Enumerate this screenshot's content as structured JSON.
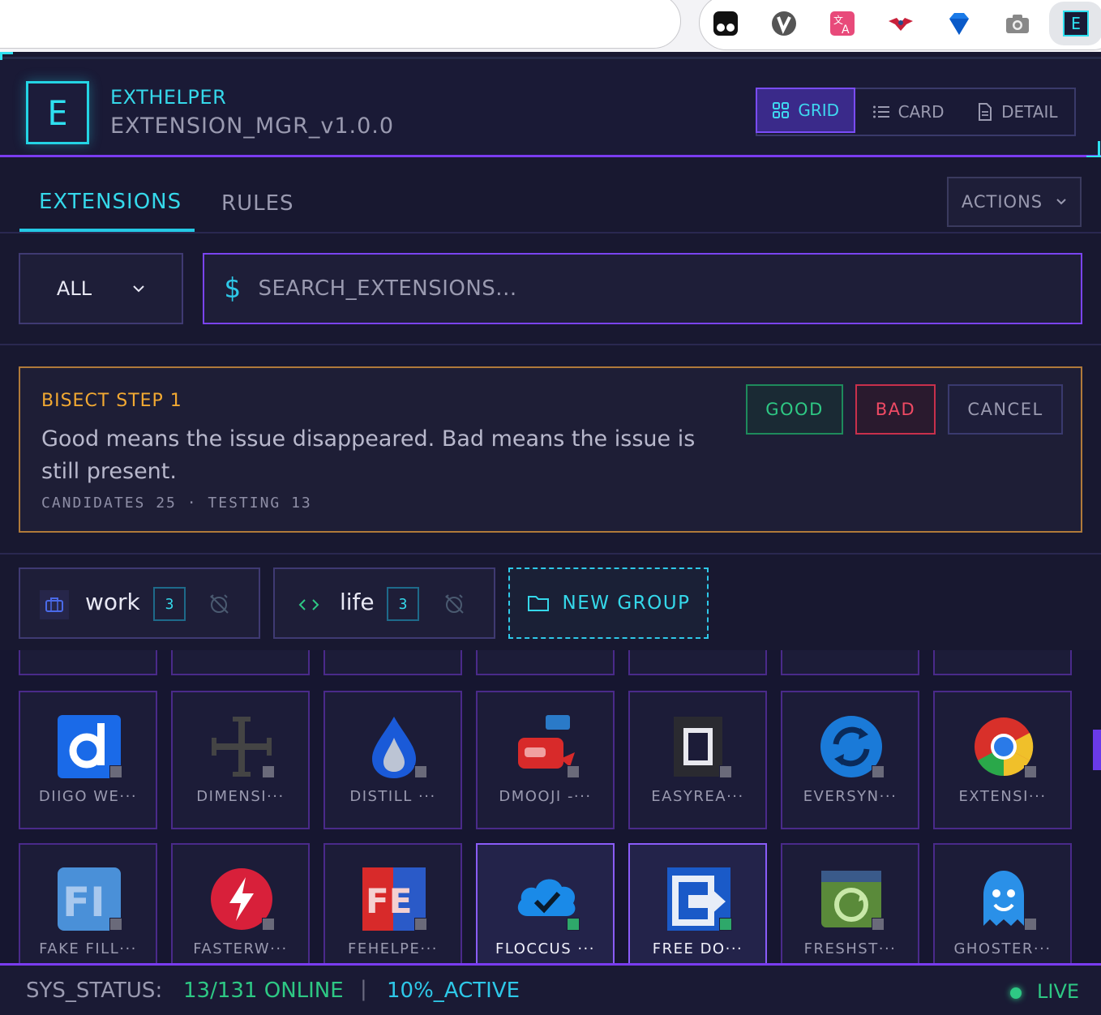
{
  "browser": {
    "extension_icons": [
      "tampermonkey-icon",
      "vimium-icon",
      "translate-icon",
      "bird-icon",
      "gem-icon",
      "camera-icon",
      "exthelper-icon"
    ],
    "active_extension_letter": "E"
  },
  "header": {
    "logo_letter": "E",
    "app_name": "EXTHELPER",
    "version": "EXTENSION_MGR_v1.0.0",
    "views": [
      {
        "label": "GRID",
        "icon": "grid-icon",
        "active": true
      },
      {
        "label": "CARD",
        "icon": "list-icon",
        "active": false
      },
      {
        "label": "DETAIL",
        "icon": "document-icon",
        "active": false
      }
    ]
  },
  "tabs": {
    "items": [
      {
        "label": "EXTENSIONS",
        "active": true
      },
      {
        "label": "RULES",
        "active": false
      }
    ],
    "actions_label": "ACTIONS"
  },
  "filter": {
    "selected": "ALL",
    "search_prompt": "$",
    "search_placeholder": "SEARCH_EXTENSIONS..."
  },
  "bisect": {
    "title": "BISECT STEP 1",
    "message": "Good means the issue disappeared. Bad means the issue is still present.",
    "meta": "CANDIDATES 25 · TESTING 13",
    "good_label": "GOOD",
    "bad_label": "BAD",
    "cancel_label": "CANCEL"
  },
  "groups": [
    {
      "name": "work",
      "count": "3",
      "icon": "briefcase-icon"
    },
    {
      "name": "life",
      "count": "3",
      "icon": "code-icon"
    }
  ],
  "new_group_label": "NEW GROUP",
  "extensions": [
    {
      "name": "DIIGO WE···",
      "icon": "diigo-icon",
      "enabled": false
    },
    {
      "name": "DIMENSI···",
      "icon": "dimensions-icon",
      "enabled": false
    },
    {
      "name": "DISTILL ···",
      "icon": "distill-icon",
      "enabled": false
    },
    {
      "name": "DMOOJI -···",
      "icon": "dmooji-icon",
      "enabled": false
    },
    {
      "name": "EASYREA···",
      "icon": "easyread-icon",
      "enabled": false
    },
    {
      "name": "EVERSYN···",
      "icon": "eversync-icon",
      "enabled": false
    },
    {
      "name": "EXTENSI···",
      "icon": "chrome-icon",
      "enabled": false
    },
    {
      "name": "FAKE FILL···",
      "icon": "fakefiller-icon",
      "enabled": false
    },
    {
      "name": "FASTERW···",
      "icon": "fasterweb-icon",
      "enabled": false
    },
    {
      "name": "FEHELPE···",
      "icon": "fehelper-icon",
      "enabled": false
    },
    {
      "name": "FLOCCUS ···",
      "icon": "floccus-icon",
      "enabled": true
    },
    {
      "name": "FREE DO···",
      "icon": "freedownload-icon",
      "enabled": true
    },
    {
      "name": "FRESHST···",
      "icon": "freshstart-icon",
      "enabled": false
    },
    {
      "name": "GHOSTER···",
      "icon": "ghostery-icon",
      "enabled": false
    }
  ],
  "status": {
    "label": "SYS_STATUS:",
    "online": "13/131 ONLINE",
    "separator": "|",
    "active": "10%_ACTIVE",
    "live": "LIVE"
  },
  "colors": {
    "accent_cyan": "#2ee0f0",
    "accent_purple": "#7a3cf0",
    "good_green": "#2ec884",
    "bad_red": "#f04a64",
    "warning_orange": "#f2a932"
  }
}
